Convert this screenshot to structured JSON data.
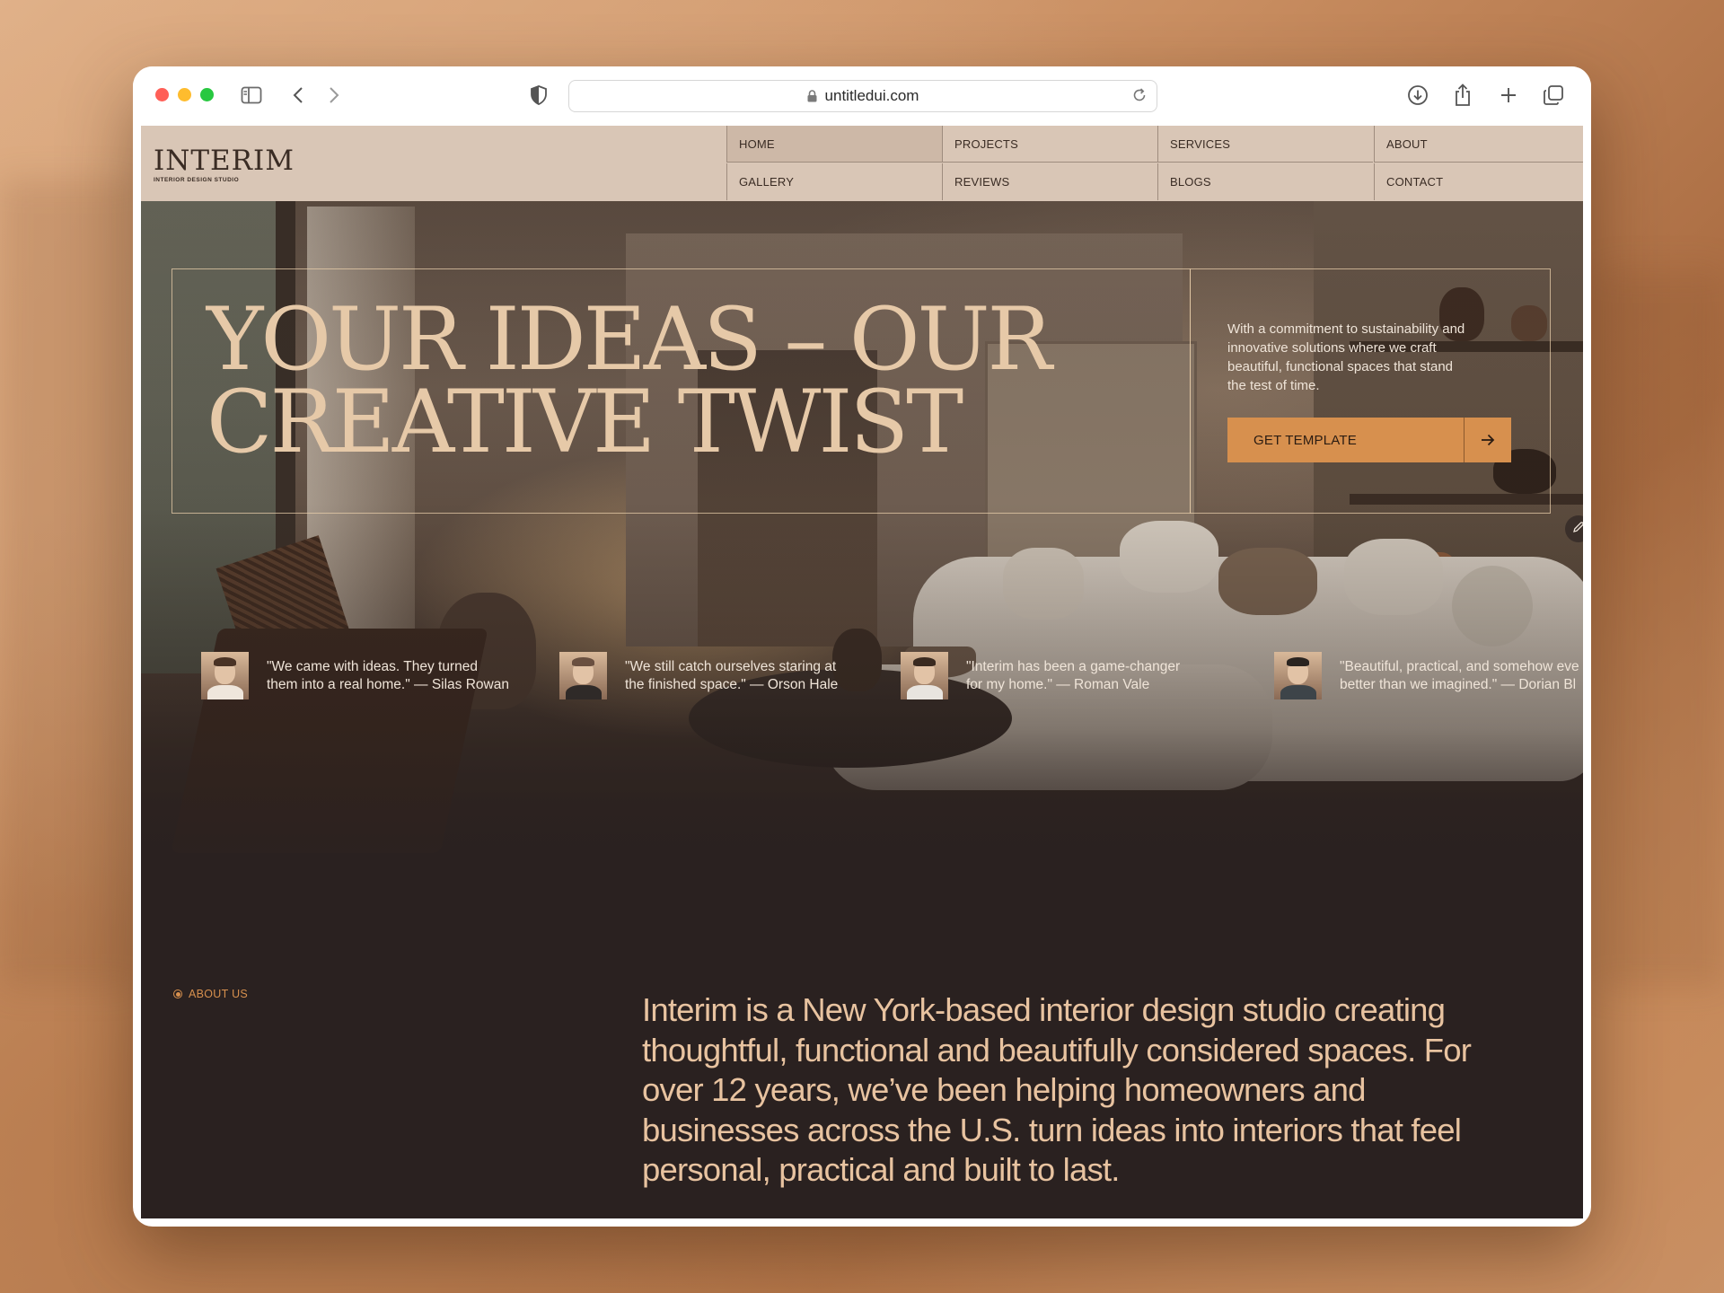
{
  "browser": {
    "url": "untitledui.com"
  },
  "nav": {
    "logo": "INTERIM",
    "logo_subtitle": "INTERIOR DESIGN STUDIO",
    "items": [
      {
        "label": "HOME"
      },
      {
        "label": "PROJECTS"
      },
      {
        "label": "SERVICES"
      },
      {
        "label": "ABOUT"
      },
      {
        "label": "GALLERY"
      },
      {
        "label": "REVIEWS"
      },
      {
        "label": "BLOGS"
      },
      {
        "label": "CONTACT"
      }
    ],
    "active": "HOME"
  },
  "hero": {
    "title": "YOUR IDEAS – OUR\nCREATIVE TWIST",
    "description": "With a commitment to sustainability and innovative solutions where we craft beautiful, functional spaces that stand the test of time.",
    "cta_label": "GET TEMPLATE",
    "cta_icon": "arrow-right-icon"
  },
  "testimonials": [
    {
      "quote": "\"We came with ideas. They turned\nthem into a real home.\" — Silas Rowan"
    },
    {
      "quote": "\"We still catch ourselves staring at\nthe finished space.\" — Orson Hale"
    },
    {
      "quote": "\"Interim has been a game-changer\nfor my home.\" — Roman Vale"
    },
    {
      "quote": "\"Beautiful, practical, and somehow eve\nbetter than we imagined.\" — Dorian Bl"
    }
  ],
  "about": {
    "tag": "ABOUT US",
    "text": "Interim is a New York-based interior design studio creating thoughtful, functional and beautifully considered spaces. For over 12 years, we’ve been helping homeowners and businesses across the U.S. turn ideas into interiors that feel personal, practical and built to last."
  },
  "colors": {
    "accent": "#d7904e",
    "nav_bg": "#d9c6b6",
    "dark_bg": "#2a2120",
    "hero_title": "#e6c9a8"
  }
}
